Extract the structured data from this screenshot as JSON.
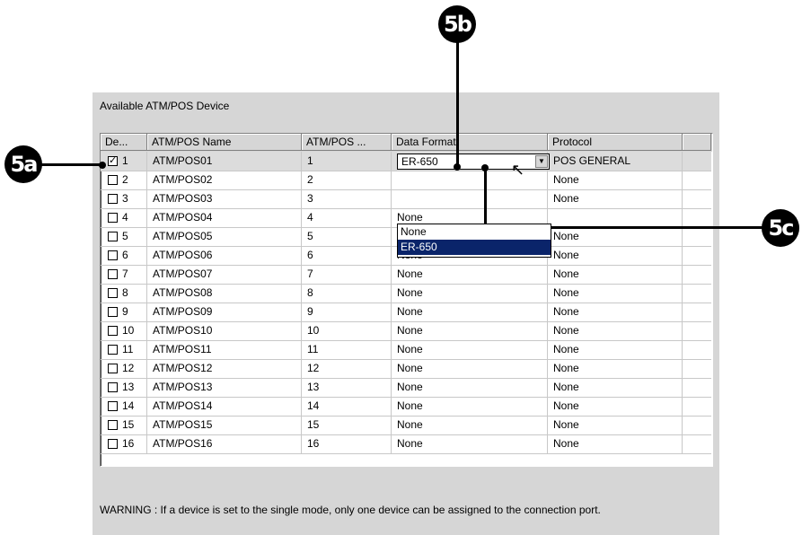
{
  "panel": {
    "title": "Available ATM/POS Device"
  },
  "columns": [
    "De...",
    "ATM/POS Name",
    "ATM/POS ...",
    "Data Format",
    "Protocol"
  ],
  "rows": [
    {
      "num": "1",
      "checked": true,
      "name": "ATM/POS01",
      "id": "1",
      "format": "",
      "protocol": "POS GENERAL"
    },
    {
      "num": "2",
      "checked": false,
      "name": "ATM/POS02",
      "id": "2",
      "format": "",
      "protocol": "None"
    },
    {
      "num": "3",
      "checked": false,
      "name": "ATM/POS03",
      "id": "3",
      "format": "",
      "protocol": "None"
    },
    {
      "num": "4",
      "checked": false,
      "name": "ATM/POS04",
      "id": "4",
      "format": "None",
      "protocol": ""
    },
    {
      "num": "5",
      "checked": false,
      "name": "ATM/POS05",
      "id": "5",
      "format": "None",
      "protocol": "None"
    },
    {
      "num": "6",
      "checked": false,
      "name": "ATM/POS06",
      "id": "6",
      "format": "None",
      "protocol": "None"
    },
    {
      "num": "7",
      "checked": false,
      "name": "ATM/POS07",
      "id": "7",
      "format": "None",
      "protocol": "None"
    },
    {
      "num": "8",
      "checked": false,
      "name": "ATM/POS08",
      "id": "8",
      "format": "None",
      "protocol": "None"
    },
    {
      "num": "9",
      "checked": false,
      "name": "ATM/POS09",
      "id": "9",
      "format": "None",
      "protocol": "None"
    },
    {
      "num": "10",
      "checked": false,
      "name": "ATM/POS10",
      "id": "10",
      "format": "None",
      "protocol": "None"
    },
    {
      "num": "11",
      "checked": false,
      "name": "ATM/POS11",
      "id": "11",
      "format": "None",
      "protocol": "None"
    },
    {
      "num": "12",
      "checked": false,
      "name": "ATM/POS12",
      "id": "12",
      "format": "None",
      "protocol": "None"
    },
    {
      "num": "13",
      "checked": false,
      "name": "ATM/POS13",
      "id": "13",
      "format": "None",
      "protocol": "None"
    },
    {
      "num": "14",
      "checked": false,
      "name": "ATM/POS14",
      "id": "14",
      "format": "None",
      "protocol": "None"
    },
    {
      "num": "15",
      "checked": false,
      "name": "ATM/POS15",
      "id": "15",
      "format": "None",
      "protocol": "None"
    },
    {
      "num": "16",
      "checked": false,
      "name": "ATM/POS16",
      "id": "16",
      "format": "None",
      "protocol": "None"
    }
  ],
  "dropdown": {
    "value": "ER-650",
    "options": [
      "None",
      "ER-650"
    ],
    "highlighted": "ER-650"
  },
  "warning": "WARNING : If a device is set to the single mode, only one device can be assigned to the connection port.",
  "callouts": {
    "a": "5a",
    "b": "5b",
    "c": "5c"
  }
}
